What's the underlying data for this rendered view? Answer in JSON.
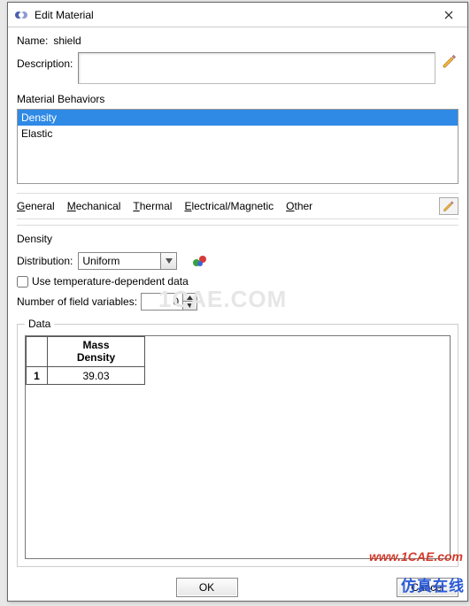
{
  "window": {
    "title": "Edit Material"
  },
  "name": {
    "label": "Name:",
    "value": "shield"
  },
  "description": {
    "label": "Description:",
    "value": ""
  },
  "behaviors_label": "Material Behaviors",
  "behaviors": [
    {
      "label": "Density",
      "selected": true
    },
    {
      "label": "Elastic",
      "selected": false
    }
  ],
  "menus": {
    "general": "General",
    "mechanical": "Mechanical",
    "thermal": "Thermal",
    "electrical": "Electrical/Magnetic",
    "other": "Other"
  },
  "section": {
    "title": "Density",
    "distribution_label": "Distribution:",
    "distribution_value": "Uniform",
    "use_temp_label": "Use temperature-dependent data",
    "use_temp_checked": false,
    "field_vars_label": "Number of field variables:",
    "field_vars_value": "0"
  },
  "data": {
    "legend": "Data",
    "columns": [
      "Mass\nDensity"
    ],
    "rows": [
      {
        "n": "1",
        "values": [
          "39.03"
        ]
      }
    ]
  },
  "buttons": {
    "ok": "OK",
    "cancel": "Cancel"
  },
  "watermarks": {
    "url": "www.1CAE.com",
    "cn": "仿真在线",
    "bg": "1CAE.COM"
  }
}
